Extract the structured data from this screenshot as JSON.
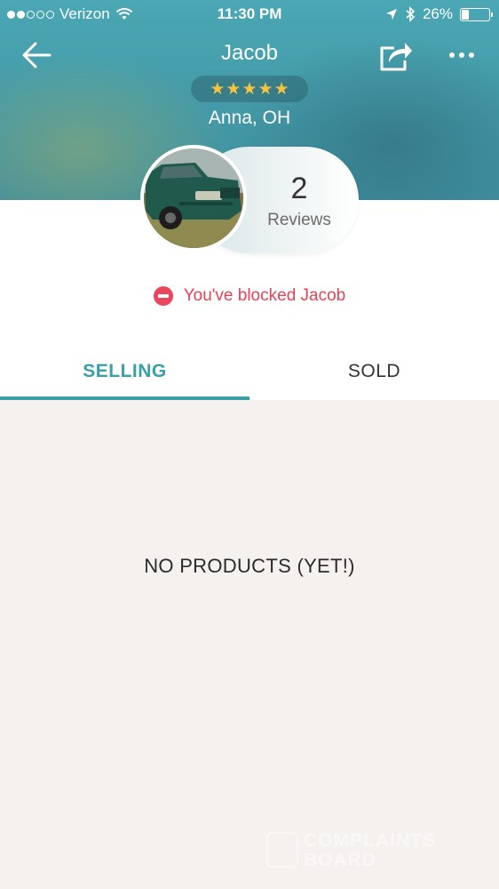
{
  "status_bar": {
    "carrier": "Verizon",
    "time": "11:30 PM",
    "battery": "26%",
    "battery_level": 0.26,
    "signal_bars_filled": 2,
    "signal_bars_total": 5
  },
  "nav": {
    "title": "Jacob",
    "back_icon": "arrow-left-icon",
    "share_icon": "share-icon",
    "more_icon": "more-horizontal-icon"
  },
  "profile": {
    "rating": 5,
    "rating_max": 5,
    "location": "Anna, OH",
    "reviews_count": "2",
    "reviews_label": "Reviews",
    "avatar_description": "green pickup truck photo"
  },
  "blocked": {
    "text": "You've blocked Jacob",
    "icon": "blocked-icon"
  },
  "tabs": [
    {
      "label": "SELLING",
      "selected": true
    },
    {
      "label": "SOLD",
      "selected": false
    }
  ],
  "empty_state": {
    "text": "NO PRODUCTS (YET!)"
  },
  "watermark": {
    "line1": "COMPLAINTS",
    "line2": "BOARD"
  },
  "colors": {
    "header_teal": "#4aa7b3",
    "accent": "#3aa0a6",
    "star": "#f6c343",
    "blocked_red": "#e14356",
    "background": "#f5f1ef"
  }
}
